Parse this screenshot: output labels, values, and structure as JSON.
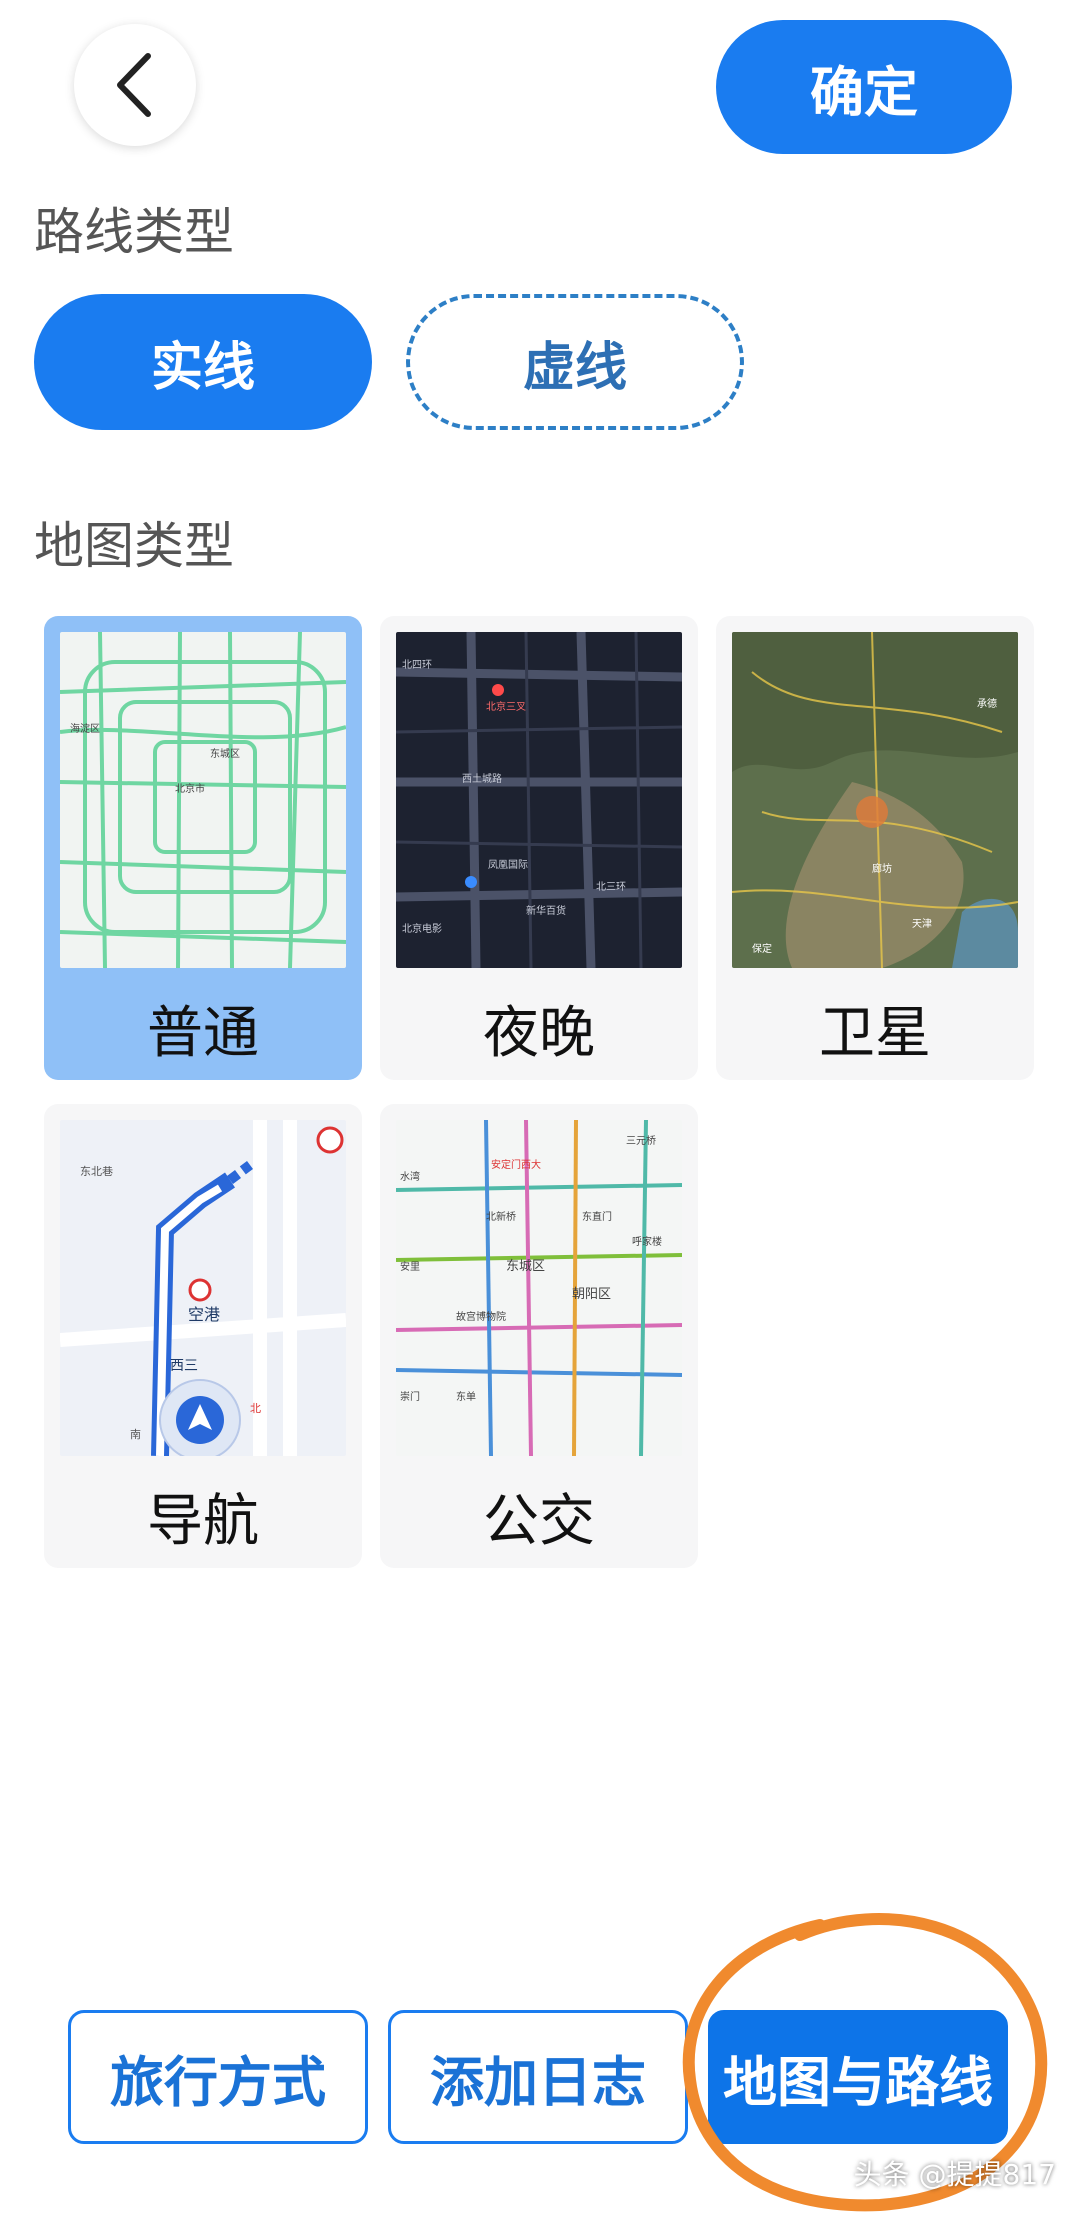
{
  "header": {
    "confirm_label": "确定"
  },
  "route_type": {
    "title": "路线类型",
    "options": [
      {
        "label": "实线",
        "selected": true
      },
      {
        "label": "虚线",
        "selected": false
      }
    ]
  },
  "map_type": {
    "title": "地图类型",
    "items": [
      {
        "label": "普通",
        "selected": true
      },
      {
        "label": "夜晚",
        "selected": false
      },
      {
        "label": "卫星",
        "selected": false
      },
      {
        "label": "导航",
        "selected": false
      },
      {
        "label": "公交",
        "selected": false
      }
    ],
    "thumbs": {
      "normal": {
        "labels": [
          "海淀区",
          "北京市",
          "东城区"
        ]
      },
      "night": {
        "labels": [
          "北四环",
          "北京三叉",
          "西土城路",
          "凤凰国际",
          "北三环",
          "北京电影",
          "新华百货"
        ]
      },
      "satellite": {
        "labels": [
          "承德",
          "廊坊",
          "天津",
          "保定"
        ]
      },
      "navigation": {
        "labels": [
          "东北巷",
          "空港",
          "西三",
          "北",
          "南"
        ]
      },
      "transit": {
        "labels": [
          "三元桥",
          "水湾",
          "安定门西大",
          "北新桥",
          "东直门",
          "东城区",
          "朝阳区",
          "故宫博物院",
          "呼家楼",
          "安里",
          "崇门",
          "东单"
        ]
      }
    }
  },
  "bottom_tabs": [
    {
      "label": "旅行方式",
      "active": false
    },
    {
      "label": "添加日志",
      "active": false
    },
    {
      "label": "地图与路线",
      "active": true
    }
  ],
  "watermark": "头条 @提提817",
  "colors": {
    "accent": "#1a7cf0",
    "selected_card": "#8fc0f7",
    "annotation_circle": "#f08a2e"
  },
  "icons": {
    "back": "chevron-left-icon"
  }
}
